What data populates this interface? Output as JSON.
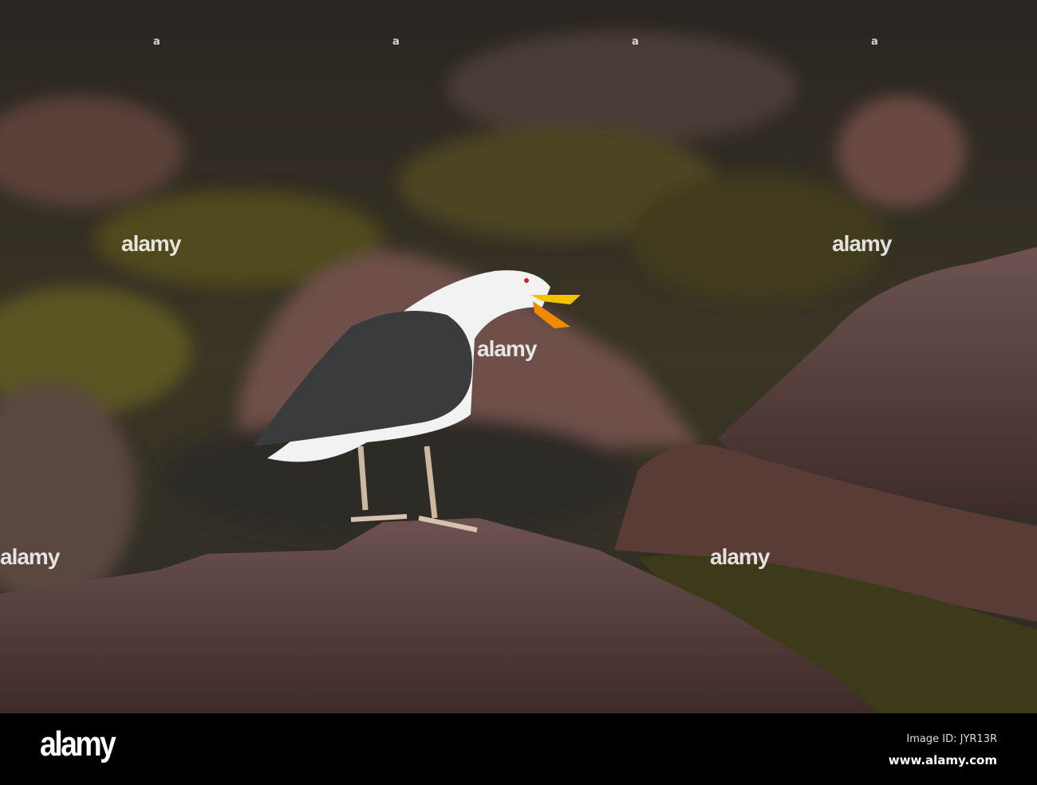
{
  "photo": {
    "subject": "great black-backed gull calling on wet rock"
  },
  "watermark": {
    "text": "alamy",
    "marker": "a"
  },
  "footer": {
    "logo": "alamy",
    "image_id": "Image ID: JYR13R",
    "website": "www.alamy.com"
  },
  "colors": {
    "rock": "#5a3f3a",
    "seaweed": "#6b6420",
    "gull_back": "#3a3b3c",
    "beak": "#f2c200"
  }
}
